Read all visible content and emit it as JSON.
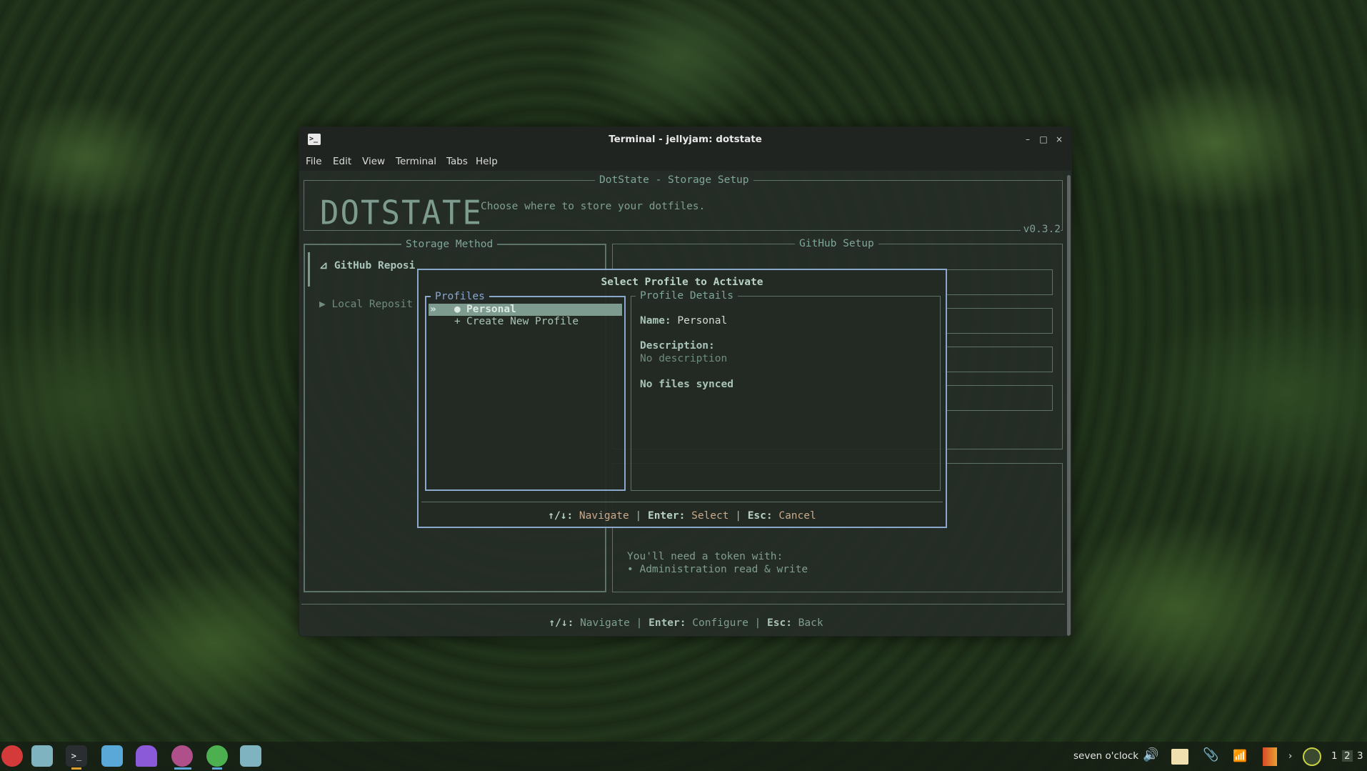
{
  "window": {
    "title": "Terminal - jellyjam: dotstate",
    "menu": [
      "File",
      "Edit",
      "View",
      "Terminal",
      "Tabs",
      "Help"
    ],
    "controls": {
      "minimize": "–",
      "maximize": "□",
      "close": "×"
    }
  },
  "app": {
    "header_title": "DotState - Storage Setup",
    "logo": "DOTSTATE",
    "subtitle": "Choose where to store your dotfiles.",
    "version": "v0.3.2",
    "storage_title": "Storage Method",
    "storage_items": [
      {
        "arrow": "⊿",
        "label": "GitHub Reposi"
      },
      {
        "arrow": "▶",
        "label": "Local Reposit"
      }
    ],
    "github_title": "GitHub Setup",
    "token_note_1": "You'll need a token with:",
    "token_note_2": "• Administration read & write",
    "footer": {
      "k1": "↑/↓:",
      "v1": "Navigate",
      "sep": "|",
      "k2": "Enter:",
      "v2": "Configure",
      "k3": "Esc:",
      "v3": "Back"
    }
  },
  "modal": {
    "title": "Select Profile to Activate",
    "profiles_title": "Profiles",
    "profiles": [
      {
        "marker": "»",
        "bullet": "●",
        "label": "Personal"
      },
      {
        "marker": "",
        "bullet": "+",
        "label": "Create New Profile"
      }
    ],
    "details_title": "Profile Details",
    "name_label": "Name:",
    "name_value": "Personal",
    "description_label": "Description:",
    "description_value": "No description",
    "files_status": "No files synced",
    "footer": {
      "k1": "↑/↓:",
      "v1": "Navigate",
      "sep": "|",
      "k2": "Enter:",
      "v2": "Select",
      "k3": "Esc:",
      "v3": "Cancel"
    }
  },
  "taskbar": {
    "clock": "seven o'clock",
    "workspaces": [
      "1",
      "2",
      "3"
    ]
  },
  "colors": {
    "accent_green": "#7fa797",
    "modal_border": "#89a8cc",
    "selection_bg": "#7d9b8e"
  }
}
